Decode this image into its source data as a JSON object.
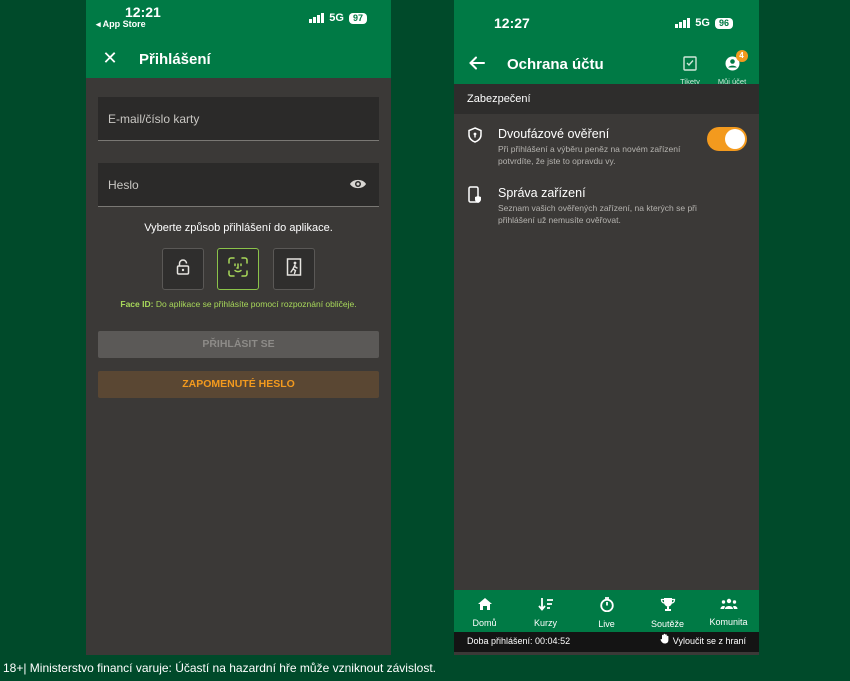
{
  "left_screen": {
    "status": {
      "time": "12:21",
      "back_app": "◂ App Store",
      "network": "5G",
      "battery": "97"
    },
    "header": {
      "title": "Přihlášení"
    },
    "email_field": {
      "placeholder": "E-mail/číslo karty"
    },
    "password_field": {
      "placeholder": "Heslo"
    },
    "login_method_prompt": "Vyberte způsob přihlášení do aplikace.",
    "login_options": [
      "lock-icon",
      "face-id-icon",
      "exit-door-icon"
    ],
    "faceid_note": {
      "label": "Face ID:",
      "text": " Do aplikace se přihlásíte pomocí rozpoznání obličeje."
    },
    "login_button": "PŘIHLÁSIT SE",
    "forgot_button": "ZAPOMENUTÉ HESLO"
  },
  "right_screen": {
    "status": {
      "time": "12:27",
      "network": "5G",
      "battery": "96"
    },
    "header": {
      "title": "Ochrana účtu",
      "tickets_label": "Tikety",
      "account_label": "Můj účet",
      "account_badge": "4"
    },
    "section_title": "Zabezpečení",
    "settings": [
      {
        "icon": "shield-icon",
        "title": "Dvoufázové ověření",
        "description": "Při přihlášení a výběru peněz na novém zařízení potvrdíte, že jste to opravdu vy.",
        "toggle_on": true
      },
      {
        "icon": "device-shield-icon",
        "title": "Správa zařízení",
        "description": "Seznam vašich ověřených zařízení, na kterých se při přihlášení už nemusíte ověřovat."
      }
    ],
    "tabs": [
      {
        "label": "Domů",
        "icon": "home-icon"
      },
      {
        "label": "Kurzy",
        "icon": "odds-icon"
      },
      {
        "label": "Live",
        "icon": "stopwatch-icon"
      },
      {
        "label": "Soutěže",
        "icon": "trophy-icon"
      },
      {
        "label": "Komunita",
        "icon": "community-icon"
      }
    ],
    "session": {
      "login_time": "Doba přihlášení: 00:04:52",
      "logout": "Vyloučit se z hraní"
    }
  },
  "footer_warning": "18+| Ministerstvo financí varuje: Účastí na hazardní hře může vzniknout závislost.",
  "colors": {
    "brand_green": "#007a45",
    "background": "#004a2a",
    "accent_orange": "#f39a1e",
    "panel": "#3b3937"
  }
}
